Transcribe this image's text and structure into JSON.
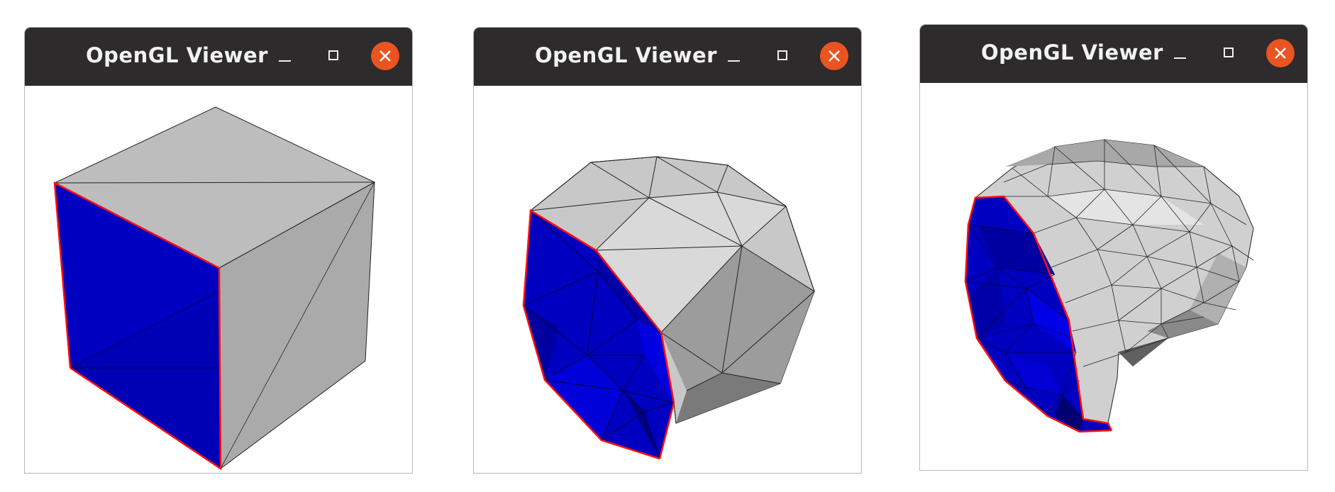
{
  "windows": [
    {
      "title": "OpenGL Viewer"
    },
    {
      "title": "OpenGL Viewer"
    },
    {
      "title": "OpenGL Viewer"
    }
  ],
  "colors": {
    "titlebar": "#2d2b2c",
    "close_button": "#e95420",
    "mesh_gray": "#b5b5b5",
    "mesh_blue": "#0000c8",
    "boundary_red": "#ff0000"
  }
}
